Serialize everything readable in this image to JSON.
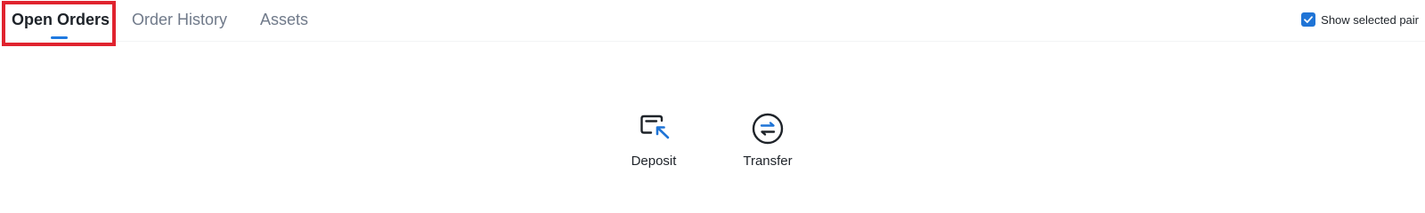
{
  "tabs": [
    {
      "label": "Open Orders",
      "active": true
    },
    {
      "label": "Order History",
      "active": false
    },
    {
      "label": "Assets",
      "active": false
    }
  ],
  "show_selected_pair": {
    "label": "Show selected pair",
    "checked": true
  },
  "actions": [
    {
      "label": "Deposit",
      "icon": "deposit-icon"
    },
    {
      "label": "Transfer",
      "icon": "transfer-icon"
    }
  ],
  "colors": {
    "accent": "#1e79e0",
    "highlight": "#e0232e",
    "text_primary": "#1e2329",
    "text_secondary": "#707a8a"
  }
}
